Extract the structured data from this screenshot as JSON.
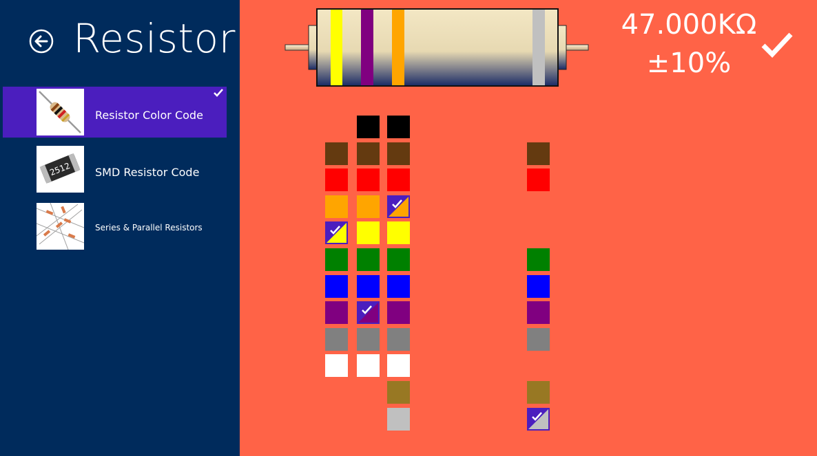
{
  "app": {
    "title": "Resistor"
  },
  "sidebar": {
    "items": [
      {
        "label": "Resistor Color Code",
        "selected": true,
        "icon": "resistor-thumbnail"
      },
      {
        "label": "SMD Resistor Code",
        "selected": false,
        "icon": "smd-resistor-thumbnail",
        "chip_text": "2512"
      },
      {
        "label": "Series & Parallel Resistors",
        "selected": false,
        "icon": "series-parallel-thumbnail"
      }
    ]
  },
  "result": {
    "value": "47.000KΩ",
    "tolerance": "±10%"
  },
  "colors": {
    "black": "#000000",
    "brown": "#643A10",
    "red": "#FF0000",
    "orange": "#FFA500",
    "yellow": "#FFFF00",
    "green": "#008000",
    "blue": "#0000FF",
    "violet": "#800080",
    "gray": "#808080",
    "white": "#FFFFFF",
    "gold": "#987823",
    "silver": "#C0C0C0",
    "accent": "#4B1EBE",
    "sidebar": "#002B5C",
    "background": "#FF6347"
  },
  "resistor": {
    "bands": [
      "yellow",
      "violet",
      "orange",
      "silver"
    ]
  },
  "picker": {
    "band1": {
      "options": [
        "brown",
        "red",
        "orange",
        "yellow",
        "green",
        "blue",
        "violet",
        "gray",
        "white"
      ],
      "selected": "yellow"
    },
    "band2": {
      "options": [
        "black",
        "brown",
        "red",
        "orange",
        "yellow",
        "green",
        "blue",
        "violet",
        "gray",
        "white"
      ],
      "selected": "violet"
    },
    "multiplier": {
      "options": [
        "black",
        "brown",
        "red",
        "orange",
        "yellow",
        "green",
        "blue",
        "violet",
        "gray",
        "white",
        "gold",
        "silver"
      ],
      "selected": "orange"
    },
    "tolerance": {
      "options": [
        "brown",
        "red",
        "green",
        "blue",
        "violet",
        "gray",
        "gold",
        "silver"
      ],
      "selected": "silver"
    }
  },
  "icons": {
    "back": "back-arrow-icon",
    "selected": "checkmark-icon",
    "confirm": "checkmark-icon"
  }
}
